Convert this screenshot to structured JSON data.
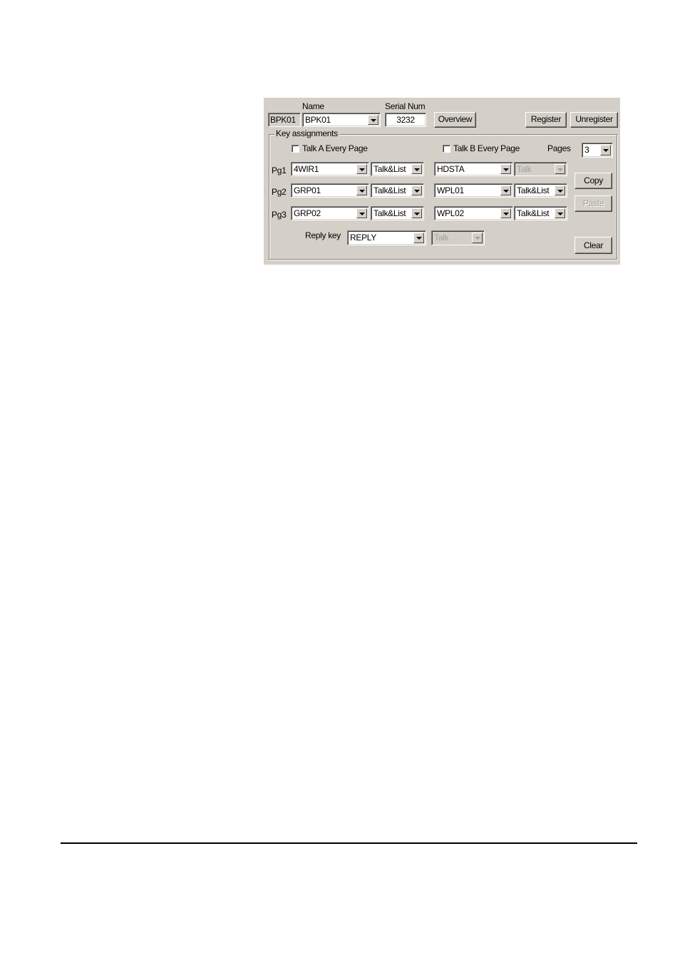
{
  "header": {
    "id_value": "BPK01",
    "name_label": "Name",
    "name_value": "BPK01",
    "serial_label": "Serial Num",
    "serial_value": "3232",
    "overview_button": "Overview",
    "register_button": "Register",
    "unregister_button": "Unregister"
  },
  "key_assignments": {
    "title": "Key assignments",
    "talk_a_every_page": {
      "label": "Talk A Every Page",
      "checked": false
    },
    "talk_b_every_page": {
      "label": "Talk B Every Page",
      "checked": false
    },
    "pages_label": "Pages",
    "pages_value": "3",
    "rows": [
      {
        "label": "Pg1",
        "key_a": "4WIR1",
        "mode_a": "Talk&List",
        "key_b": "HDSTA",
        "mode_b": "Talk",
        "mode_b_disabled": true
      },
      {
        "label": "Pg2",
        "key_a": "GRP01",
        "mode_a": "Talk&List",
        "key_b": "WPL01",
        "mode_b": "Talk&List",
        "mode_b_disabled": false
      },
      {
        "label": "Pg3",
        "key_a": "GRP02",
        "mode_a": "Talk&List",
        "key_b": "WPL02",
        "mode_b": "Talk&List",
        "mode_b_disabled": false
      }
    ],
    "reply_key_label": "Reply key",
    "reply_key_value": "REPLY",
    "reply_mode_value": "Talk",
    "copy_button": "Copy",
    "paste_button": "Paste",
    "clear_button": "Clear"
  }
}
